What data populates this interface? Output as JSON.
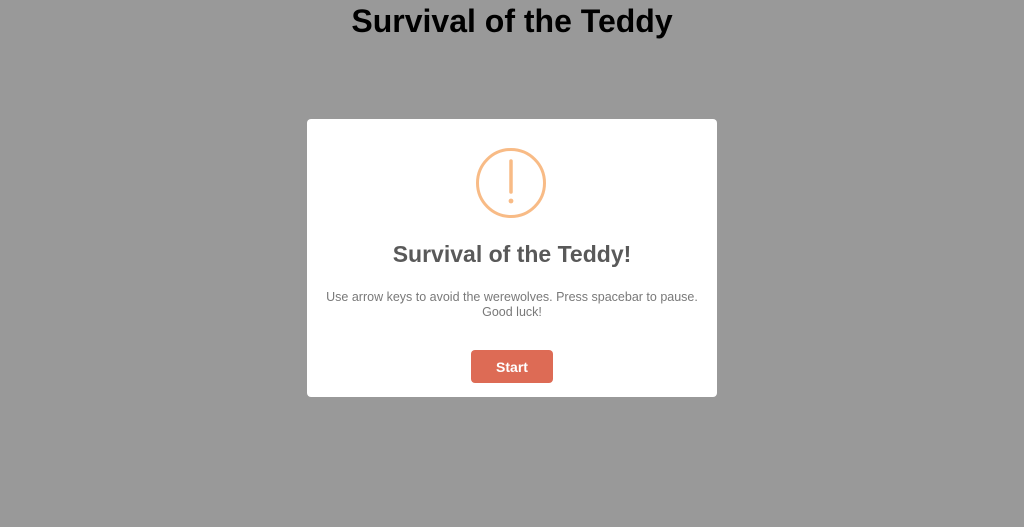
{
  "page": {
    "title": "Survival of the Teddy"
  },
  "modal": {
    "icon": "warning-icon",
    "icon_color": "#f8bb86",
    "title": "Survival of the Teddy!",
    "text": "Use arrow keys to avoid the werewolves. Press spacebar to pause. Good luck!",
    "button_label": "Start",
    "button_color": "#dd6b55"
  },
  "colors": {
    "background": "#999999",
    "modal_background": "#ffffff"
  }
}
